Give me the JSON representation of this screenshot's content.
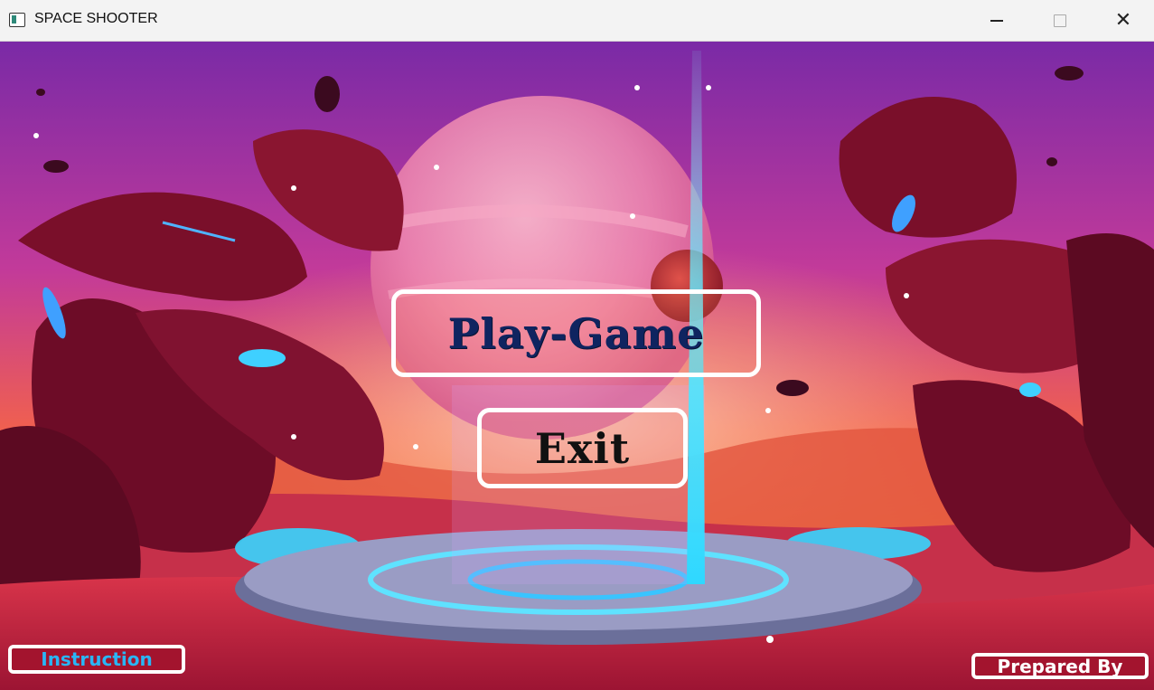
{
  "window": {
    "title": "SPACE SHOOTER",
    "minimize_icon": "minimize-icon",
    "maximize_icon": "maximize-icon",
    "close_icon": "close-icon"
  },
  "menu": {
    "play_label": "Play-Game",
    "exit_label": "Exit",
    "instruction_label": "Instruction",
    "prepared_label": "Prepared By"
  },
  "colors": {
    "play_text": "#0f2460",
    "instruction_text": "#29b6f6",
    "button_border": "#ffffff",
    "small_button_bg": "#a3142e"
  }
}
